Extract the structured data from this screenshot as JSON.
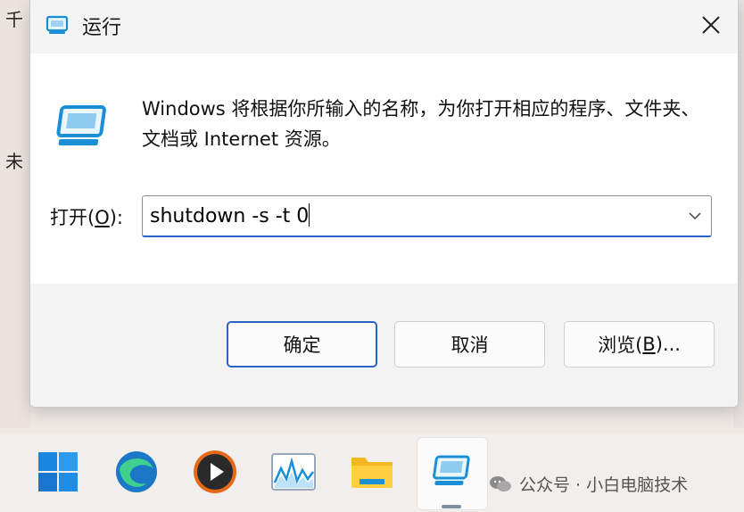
{
  "background": {
    "left_chars": [
      "千",
      "未"
    ]
  },
  "dialog": {
    "title": "运行",
    "description": "Windows 将根据你所输入的名称，为你打开相应的程序、文件夹、文档或 Internet 资源。",
    "open_label_prefix": "打开(",
    "open_label_key": "O",
    "open_label_suffix": "):",
    "command_value": "shutdown -s -t 0",
    "buttons": {
      "ok": "确定",
      "cancel": "取消",
      "browse_prefix": "浏览(",
      "browse_key": "B",
      "browse_suffix": ")..."
    }
  },
  "taskbar": {
    "icons": [
      "windows-start-icon",
      "edge-browser-icon",
      "media-player-icon",
      "performance-monitor-icon",
      "file-explorer-icon",
      "run-dialog-icon"
    ],
    "watermark": "公众号 · 小白电脑技术"
  },
  "colors": {
    "accent": "#2b63c4",
    "icon_blue": "#1b8fd6"
  }
}
